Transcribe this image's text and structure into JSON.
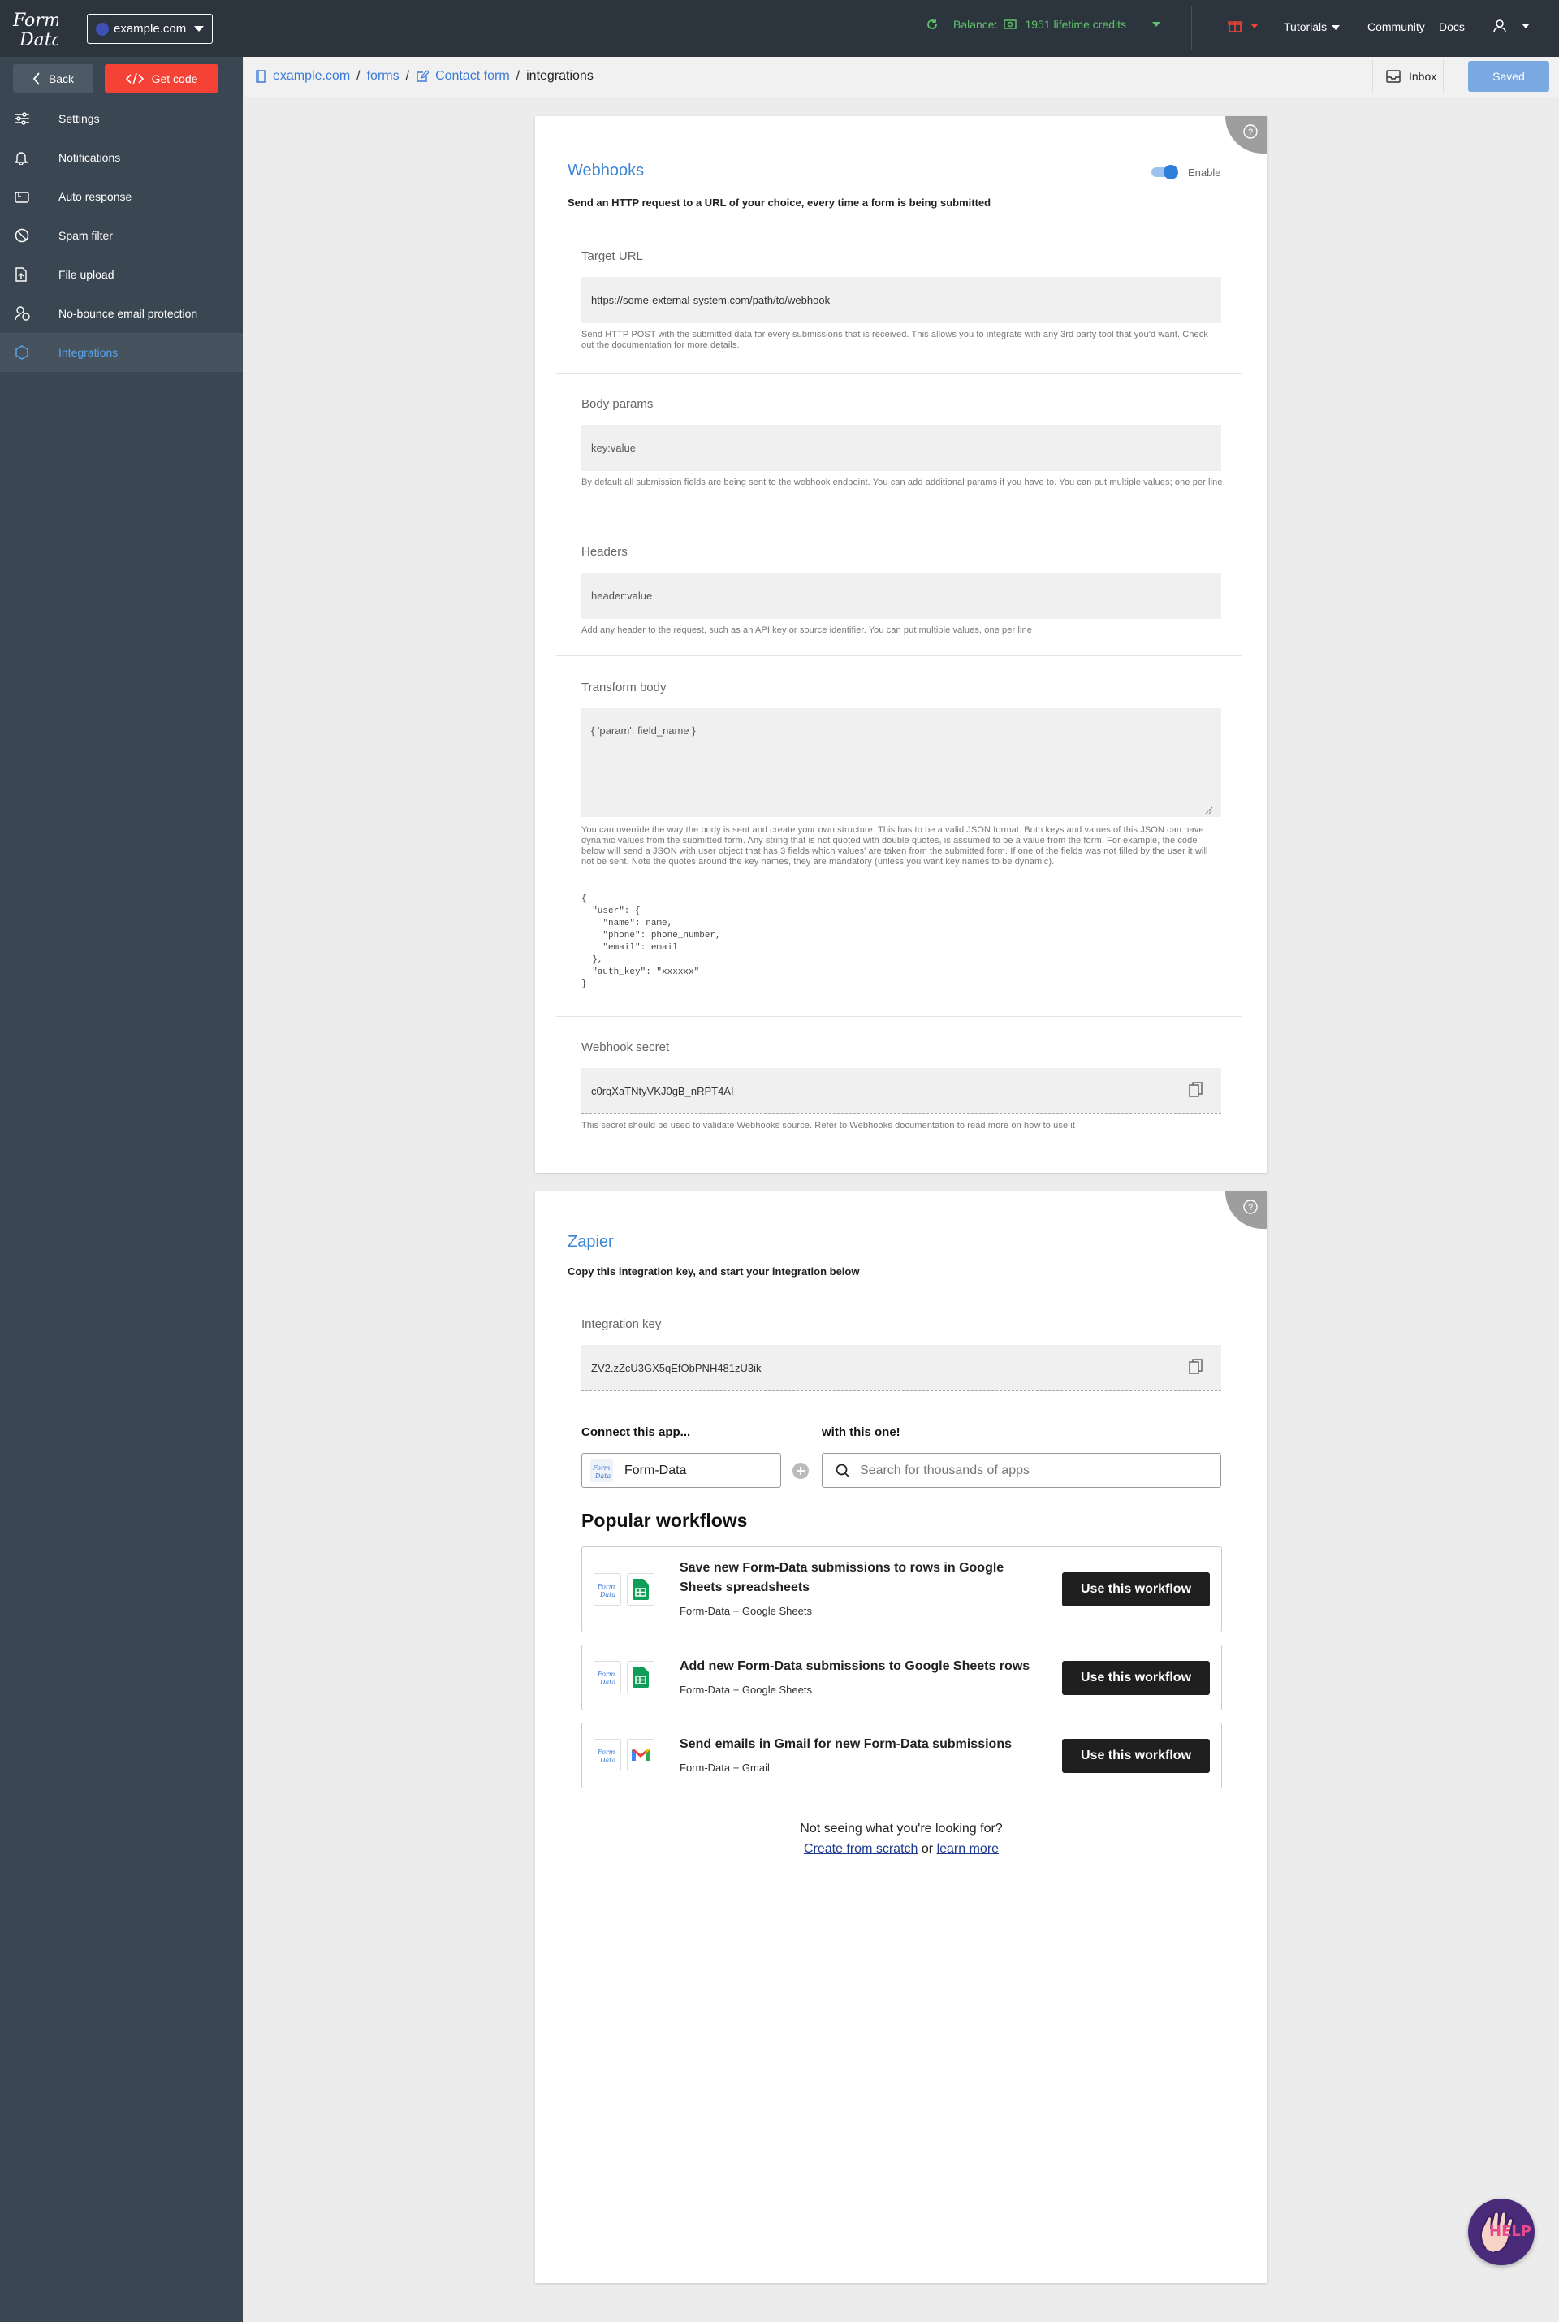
{
  "topbar": {
    "site": "example.com",
    "balance_label": "Balance:",
    "balance_value": "1951 lifetime credits",
    "tutorials": "Tutorials",
    "community": "Community",
    "docs": "Docs"
  },
  "sidebar": {
    "back": "Back",
    "get_code": "Get code",
    "items": [
      {
        "label": "Settings",
        "icon": "sliders-icon"
      },
      {
        "label": "Notifications",
        "icon": "bell-icon"
      },
      {
        "label": "Auto response",
        "icon": "mailbox-icon"
      },
      {
        "label": "Spam filter",
        "icon": "ban-icon"
      },
      {
        "label": "File upload",
        "icon": "file-upload-icon"
      },
      {
        "label": "No-bounce email protection",
        "icon": "person-shield-icon"
      },
      {
        "label": "Integrations",
        "icon": "integrations-icon"
      }
    ]
  },
  "breadcrumb": {
    "site": "example.com",
    "forms": "forms",
    "form": "Contact form",
    "current": "integrations",
    "sep": "/"
  },
  "actions": {
    "inbox": "Inbox",
    "saved": "Saved"
  },
  "webhooks": {
    "title": "Webhooks",
    "enable_label": "Enable",
    "enabled": true,
    "subtitle": "Send an HTTP request to a URL of your choice, every time a form is being submitted",
    "target_url": {
      "label": "Target URL",
      "value": "https://some-external-system.com/path/to/webhook",
      "help": "Send HTTP POST with the submitted data for every submissions that is received. This allows you to integrate with any 3rd party tool that you'd want. Check out the documentation for more details."
    },
    "body_params": {
      "label": "Body params",
      "placeholder": "key:value",
      "help": "By default all submission fields are being sent to the webhook endpoint. You can add additional params if you have to. You can put multiple values; one per line"
    },
    "headers": {
      "label": "Headers",
      "placeholder": "header:value",
      "help": "Add any header to the request, such as an API key or source identifier. You can put multiple values, one per line"
    },
    "transform_body": {
      "label": "Transform body",
      "placeholder": "{ 'param': field_name }",
      "help": "You can override the way the body is sent and create your own structure. This has to be a valid JSON format. Both keys and values of this JSON can have dynamic values from the submitted form. Any string that is not quoted with double quotes, is assumed to be a value from the form. For example, the code below will send a JSON with user object that has 3 fields which values' are taken from the submitted form. If one of the fields was not filled by the user it will not be sent. Note the quotes around the key names, they are mandatory (unless you want key names to be dynamic).",
      "example": "{\n  \"user\": {\n    \"name\": name,\n    \"phone\": phone_number,\n    \"email\": email\n  },\n  \"auth_key\": \"xxxxxx\"\n}"
    },
    "secret": {
      "label": "Webhook secret",
      "value": "c0rqXaTNtyVKJ0gB_nRPT4AI",
      "help": "This secret should be used to validate Webhooks source. Refer to Webhooks documentation to read more on how to use it"
    }
  },
  "zapier": {
    "title": "Zapier",
    "subtitle": "Copy this integration key, and start your integration below",
    "key_label": "Integration key",
    "key_value": "ZV2.zZcU3GX5qEfObPNH481zU3ik",
    "connect_label": "Connect this app...",
    "with_label": "with this one!",
    "app_name": "Form-Data",
    "search_placeholder": "Search for thousands of apps",
    "popular_title": "Popular workflows",
    "workflows": [
      {
        "title": "Save new Form-Data submissions to rows in Google Sheets spreadsheets",
        "apps": "Form-Data + Google Sheets",
        "icon": "google-sheets-icon",
        "button": "Use this workflow"
      },
      {
        "title": "Add new Form-Data submissions to Google Sheets rows",
        "apps": "Form-Data + Google Sheets",
        "icon": "google-sheets-icon",
        "button": "Use this workflow"
      },
      {
        "title": "Send emails in Gmail for new Form-Data submissions",
        "apps": "Form-Data + Gmail",
        "icon": "gmail-icon",
        "button": "Use this workflow"
      }
    ],
    "not_seeing": "Not seeing what you're looking for?",
    "create_link": "Create from scratch",
    "or": "or",
    "learn_link": "learn more"
  },
  "help_widget": "HELP",
  "colors": {
    "accent": "#3c86d6",
    "danger": "#f44336",
    "sidebar": "#3a4651",
    "topbar": "#2c353e",
    "balance": "#5ec26a"
  }
}
